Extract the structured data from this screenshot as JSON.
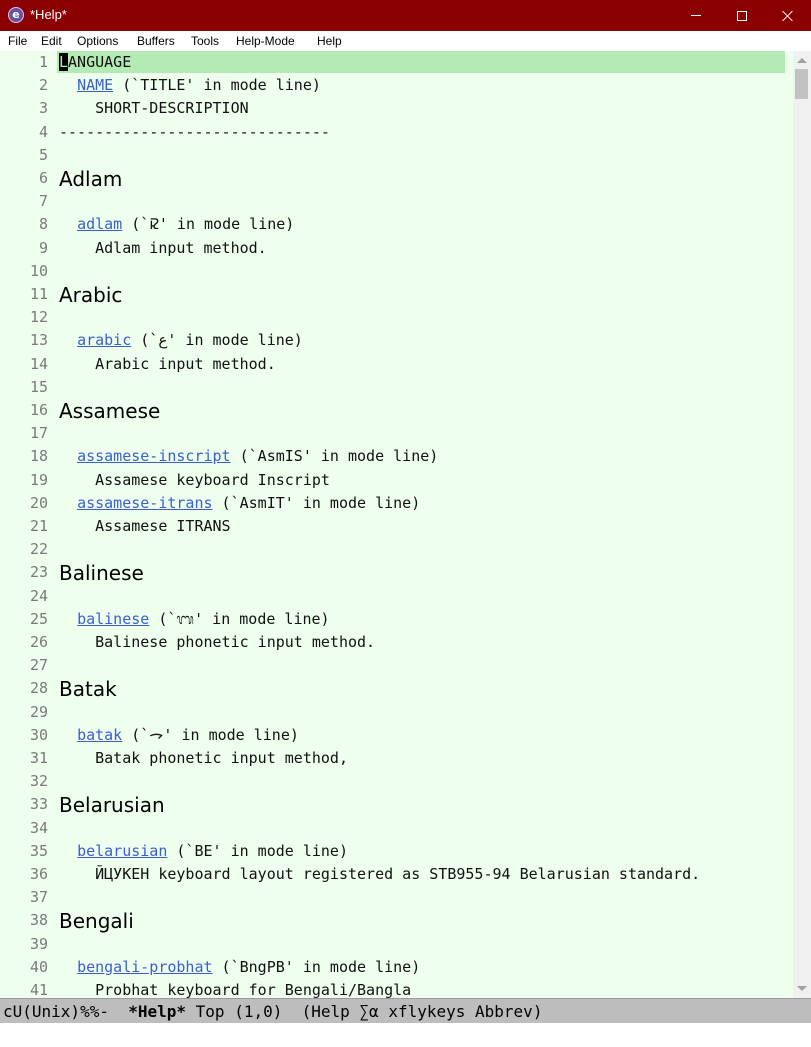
{
  "window": {
    "title": "*Help*",
    "app_icon": "emacs-icon"
  },
  "menu": [
    "File",
    "Edit",
    "Options",
    "Buffers",
    "Tools",
    "Help-Mode",
    "Help"
  ],
  "buffer": {
    "lines": [
      {
        "n": "1",
        "k": "cursor",
        "cursor": "L",
        "rest": "ANGUAGE"
      },
      {
        "n": "2",
        "k": "link",
        "pre": "  ",
        "link": "NAME",
        "post": " (`TITLE' in mode line)"
      },
      {
        "n": "3",
        "k": "text",
        "t": "    SHORT-DESCRIPTION"
      },
      {
        "n": "4",
        "k": "text",
        "t": "------------------------------"
      },
      {
        "n": "5",
        "k": "blank"
      },
      {
        "n": "6",
        "k": "heading",
        "t": "Adlam"
      },
      {
        "n": "7",
        "k": "blank"
      },
      {
        "n": "8",
        "k": "link",
        "pre": "  ",
        "link": "adlam",
        "post": " (`𞤞' in mode line)"
      },
      {
        "n": "9",
        "k": "text",
        "t": "    Adlam input method."
      },
      {
        "n": "10",
        "k": "blank"
      },
      {
        "n": "11",
        "k": "heading",
        "t": "Arabic"
      },
      {
        "n": "12",
        "k": "blank"
      },
      {
        "n": "13",
        "k": "link",
        "pre": "  ",
        "link": "arabic",
        "post": " (`ع' in mode line)"
      },
      {
        "n": "14",
        "k": "text",
        "t": "    Arabic input method."
      },
      {
        "n": "15",
        "k": "blank"
      },
      {
        "n": "16",
        "k": "heading",
        "t": "Assamese"
      },
      {
        "n": "17",
        "k": "blank"
      },
      {
        "n": "18",
        "k": "link",
        "pre": "  ",
        "link": "assamese-inscript",
        "post": " (`AsmIS' in mode line)"
      },
      {
        "n": "19",
        "k": "text",
        "t": "    Assamese keyboard Inscript"
      },
      {
        "n": "20",
        "k": "link",
        "pre": "  ",
        "link": "assamese-itrans",
        "post": " (`AsmIT' in mode line)"
      },
      {
        "n": "21",
        "k": "text",
        "t": "    Assamese ITRANS"
      },
      {
        "n": "22",
        "k": "blank"
      },
      {
        "n": "23",
        "k": "heading",
        "t": "Balinese"
      },
      {
        "n": "24",
        "k": "blank"
      },
      {
        "n": "25",
        "k": "link",
        "pre": "  ",
        "link": "balinese",
        "post": " (`ᬩ' in mode line)"
      },
      {
        "n": "26",
        "k": "text",
        "t": "    Balinese phonetic input method."
      },
      {
        "n": "27",
        "k": "blank"
      },
      {
        "n": "28",
        "k": "heading",
        "t": "Batak"
      },
      {
        "n": "29",
        "k": "blank"
      },
      {
        "n": "30",
        "k": "link",
        "pre": "  ",
        "link": "batak",
        "post": " (`ᯎ' in mode line)"
      },
      {
        "n": "31",
        "k": "text",
        "t": "    Batak phonetic input method,"
      },
      {
        "n": "32",
        "k": "blank"
      },
      {
        "n": "33",
        "k": "heading",
        "t": "Belarusian"
      },
      {
        "n": "34",
        "k": "blank"
      },
      {
        "n": "35",
        "k": "link",
        "pre": "  ",
        "link": "belarusian",
        "post": " (`BE' in mode line)"
      },
      {
        "n": "36",
        "k": "text",
        "t": "    ЙЦУКЕН keyboard layout registered as STB955-94 Belarusian standard."
      },
      {
        "n": "37",
        "k": "blank"
      },
      {
        "n": "38",
        "k": "heading",
        "t": "Bengali"
      },
      {
        "n": "39",
        "k": "blank"
      },
      {
        "n": "40",
        "k": "link",
        "pre": "  ",
        "link": "bengali-probhat",
        "post": " (`BngPB' in mode line)"
      },
      {
        "n": "41",
        "k": "text",
        "t": "    Probhat keyboard for Bengali/Bangla"
      }
    ]
  },
  "modeline": {
    "prefix": "cU(Unix)%%-  ",
    "buffer_name": "*Help*",
    "rest": " Top (1,0)  (Help ∑α xflykeys Abbrev)"
  },
  "colors": {
    "titlebar": "#8b0000",
    "buffer_bg": "#eeffee",
    "current_line": "#b4eab4",
    "link": "#3a5fcd",
    "modeline": "#bdbdbd"
  }
}
